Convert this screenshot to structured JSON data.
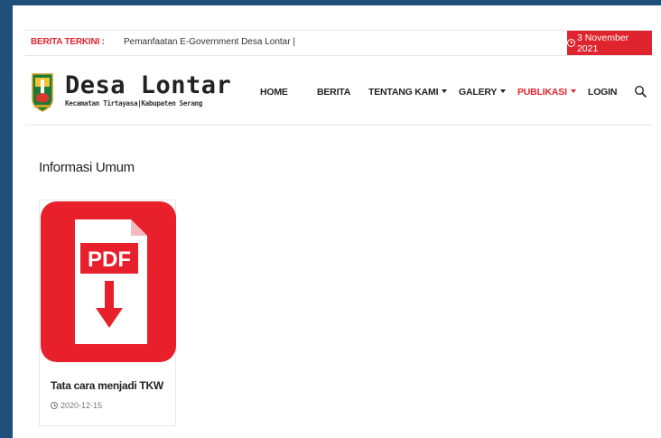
{
  "ticker": {
    "label": "BERITA TERKINI :",
    "headline": "Pemanfaatan E-Government Desa Lontar |",
    "date": "3 November 2021",
    "icon": "clock-icon"
  },
  "header": {
    "logo_icon": "regency-emblem-icon",
    "site_name": "Desa Lontar",
    "site_subtitle": "Kecamatan Tirtayasa|Kabupaten Serang",
    "search_icon": "search-icon"
  },
  "nav": {
    "home": "HOME",
    "berita": "BERITA",
    "tentang_kami": "TENTANG KAMI",
    "galery": "GALERY",
    "publikasi": "PUBLIKASI",
    "login": "LOGIN"
  },
  "main": {
    "section_title": "Informasi Umum",
    "cards": [
      {
        "thumb_label": "PDF",
        "title": "Tata cara menjadi TKW",
        "date": "2020-12-15"
      }
    ]
  },
  "colors": {
    "accent": "#e0242e",
    "frame": "#1f4e79",
    "pdf_red": "#e8202c"
  }
}
